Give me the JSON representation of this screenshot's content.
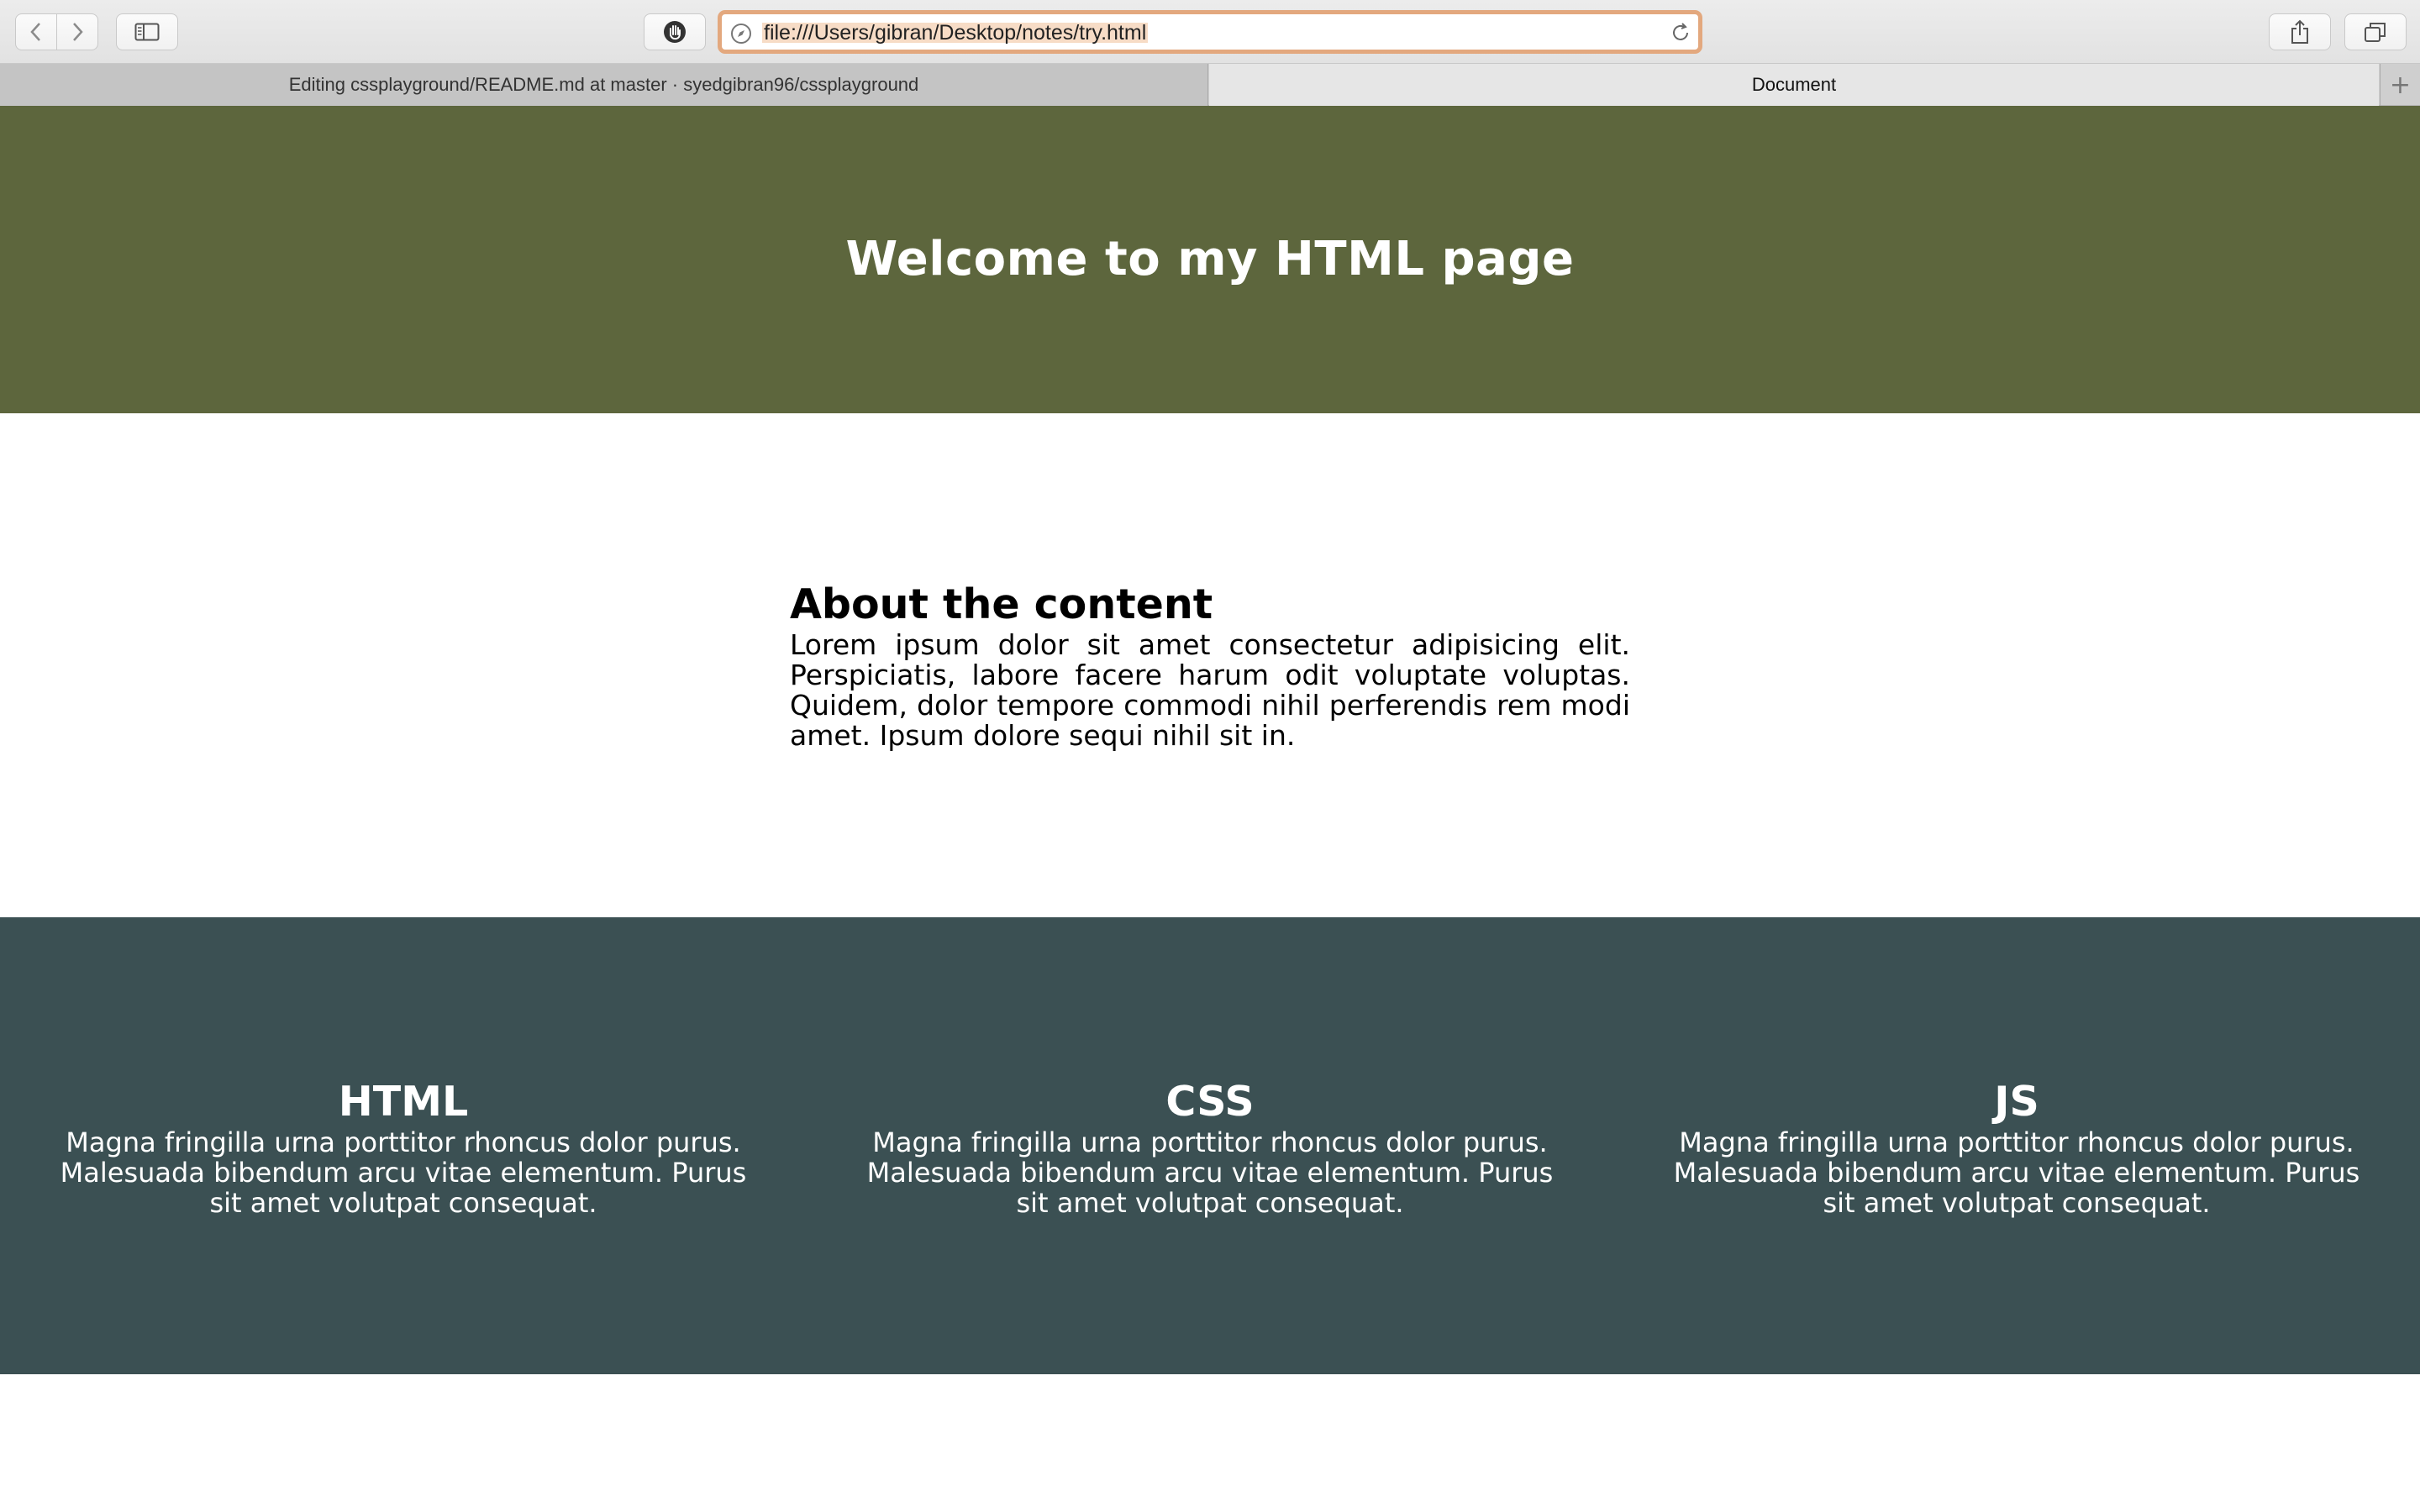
{
  "browser": {
    "url": "file:///Users/gibran/Desktop/notes/try.html",
    "tabs": [
      {
        "label": "Editing cssplayground/README.md at master · syedgibran96/cssplayground",
        "active": false
      },
      {
        "label": "Document",
        "active": true
      }
    ],
    "new_tab_label": "+",
    "icons": {
      "back": "chevron-left-icon",
      "forward": "chevron-right-icon",
      "sidebar": "sidebar-icon",
      "privacy": "hand-icon",
      "site": "compass-icon",
      "reload": "reload-icon",
      "share": "share-icon",
      "tabs": "tabs-overview-icon"
    },
    "address_highlight_color": "#e3a87e"
  },
  "page": {
    "hero": {
      "title": "Welcome to my HTML page",
      "background": "#5d663d"
    },
    "about": {
      "heading": "About the content",
      "body": "Lorem ipsum dolor sit amet consectetur adipisicing elit. Perspiciatis, labore facere harum odit voluptate voluptas. Quidem, dolor tempore commodi nihil perferendis rem modi amet. Ipsum dolore sequi nihil sit in."
    },
    "features": {
      "background": "#3b5053",
      "items": [
        {
          "title": "HTML",
          "body": "Magna fringilla urna porttitor rhoncus dolor purus. Malesuada bibendum arcu vitae elementum. Purus sit amet volutpat consequat."
        },
        {
          "title": "CSS",
          "body": "Magna fringilla urna porttitor rhoncus dolor purus. Malesuada bibendum arcu vitae elementum. Purus sit amet volutpat consequat."
        },
        {
          "title": "JS",
          "body": "Magna fringilla urna porttitor rhoncus dolor purus. Malesuada bibendum arcu vitae elementum. Purus sit amet volutpat consequat."
        }
      ]
    }
  }
}
